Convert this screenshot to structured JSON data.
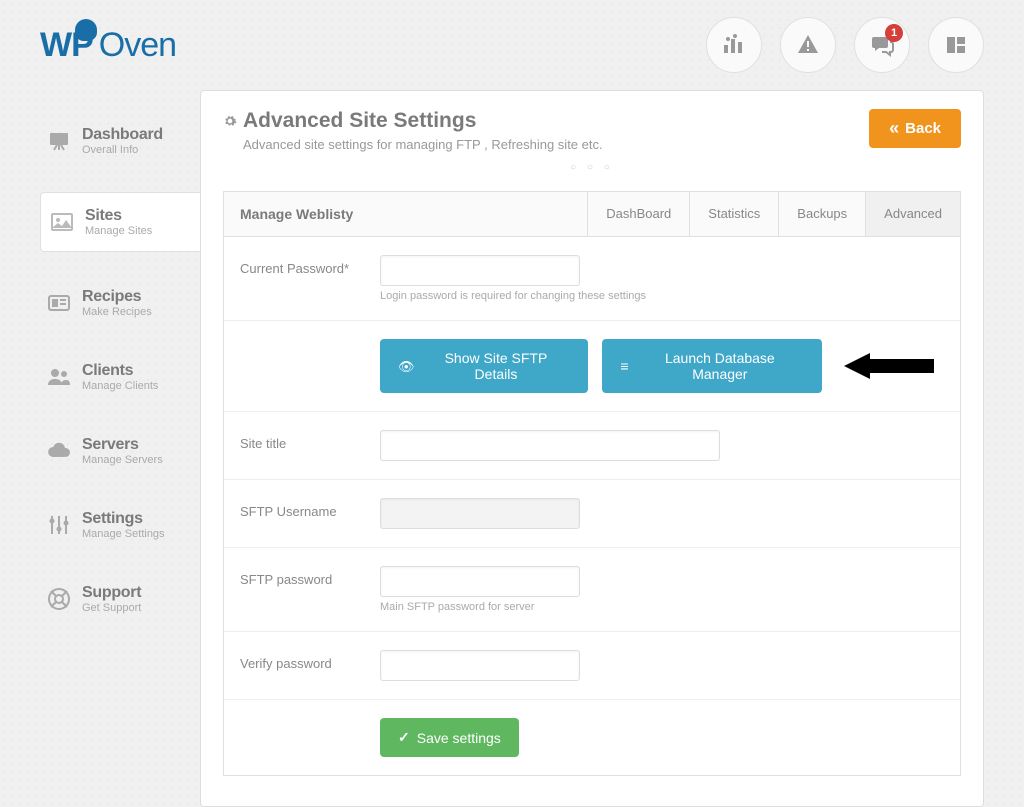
{
  "logo": {
    "part1": "WP",
    "part2": "Oven"
  },
  "header_badge": "1",
  "sidebar": {
    "items": [
      {
        "title": "Dashboard",
        "sub": "Overall Info"
      },
      {
        "title": "Sites",
        "sub": "Manage Sites"
      },
      {
        "title": "Recipes",
        "sub": "Make Recipes"
      },
      {
        "title": "Clients",
        "sub": "Manage Clients"
      },
      {
        "title": "Servers",
        "sub": "Manage Servers"
      },
      {
        "title": "Settings",
        "sub": "Manage Settings"
      },
      {
        "title": "Support",
        "sub": "Get Support"
      }
    ]
  },
  "page": {
    "title": "Advanced Site Settings",
    "subtitle": "Advanced site settings for managing FTP , Refreshing site etc.",
    "back": "Back"
  },
  "tabs": {
    "main": "Manage Weblisty",
    "items": [
      "DashBoard",
      "Statistics",
      "Backups",
      "Advanced"
    ]
  },
  "form": {
    "current_pw_label": "Current Password*",
    "current_pw_helper": "Login password is required for changing these settings",
    "show_sftp": "Show Site SFTP Details",
    "launch_db": "Launch Database Manager",
    "site_title_label": "Site title",
    "site_title_value": "",
    "sftp_user_label": "SFTP Username",
    "sftp_user_value": "",
    "sftp_pw_label": "SFTP password",
    "sftp_pw_helper": "Main SFTP password for server",
    "verify_pw_label": "Verify password",
    "save": "Save settings"
  }
}
